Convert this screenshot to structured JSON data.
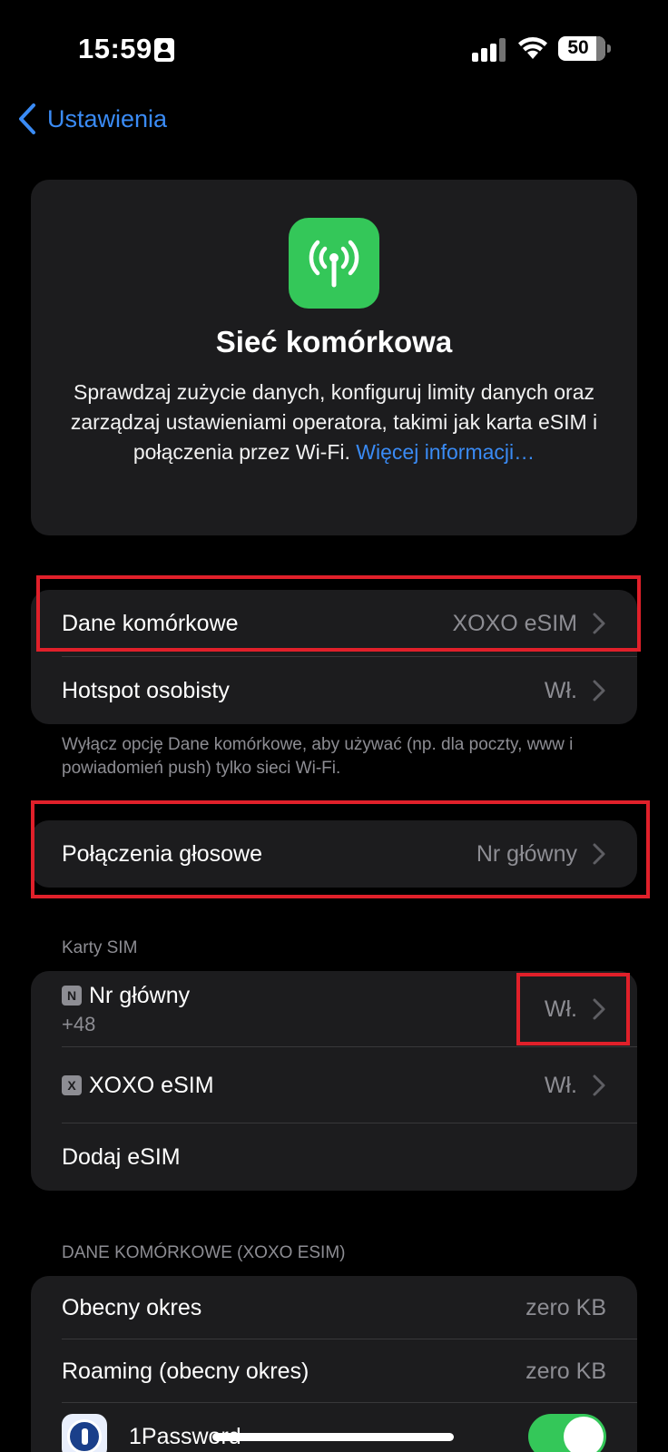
{
  "status_bar": {
    "time": "15:59",
    "battery": "50"
  },
  "nav": {
    "back_label": "Ustawienia"
  },
  "hero": {
    "title": "Sieć komórkowa",
    "description": "Sprawdzaj zużycie danych, konfiguruj limity danych oraz zarządzaj ustawieniami operatora, takimi jak karta eSIM i połączenia przez Wi-Fi.",
    "more_link": "Więcej informacji…",
    "icon_color": "#34c759"
  },
  "group1": {
    "rows": [
      {
        "label": "Dane komórkowe",
        "value": "XOXO eSIM"
      },
      {
        "label": "Hotspot osobisty",
        "value": "Wł."
      }
    ],
    "footnote": "Wyłącz opcję Dane komórkowe, aby używać (np. dla poczty, www i powiadomień push) tylko sieci Wi-Fi."
  },
  "group2": {
    "label": "Połączenia głosowe",
    "value": "Nr główny"
  },
  "sim_cards": {
    "header": "Karty SIM",
    "primary": {
      "badge": "N",
      "label": "Nr główny",
      "sub": "+48",
      "value": "Wł."
    },
    "esim": {
      "badge": "X",
      "label": "XOXO eSIM",
      "value": "Wł."
    },
    "add_label": "Dodaj eSIM"
  },
  "data_usage": {
    "header": "DANE KOMÓRKOWE (XOXO ESIM)",
    "rows": [
      {
        "label": "Obecny okres",
        "value": "zero KB"
      },
      {
        "label": "Roaming (obecny okres)",
        "value": "zero KB"
      }
    ],
    "app": {
      "label": "1Password",
      "enabled": true
    }
  },
  "colors": {
    "accent": "#3a8bf5",
    "highlight": "#e0202a",
    "toggle_on": "#34c759",
    "card": "#1c1c1e"
  }
}
